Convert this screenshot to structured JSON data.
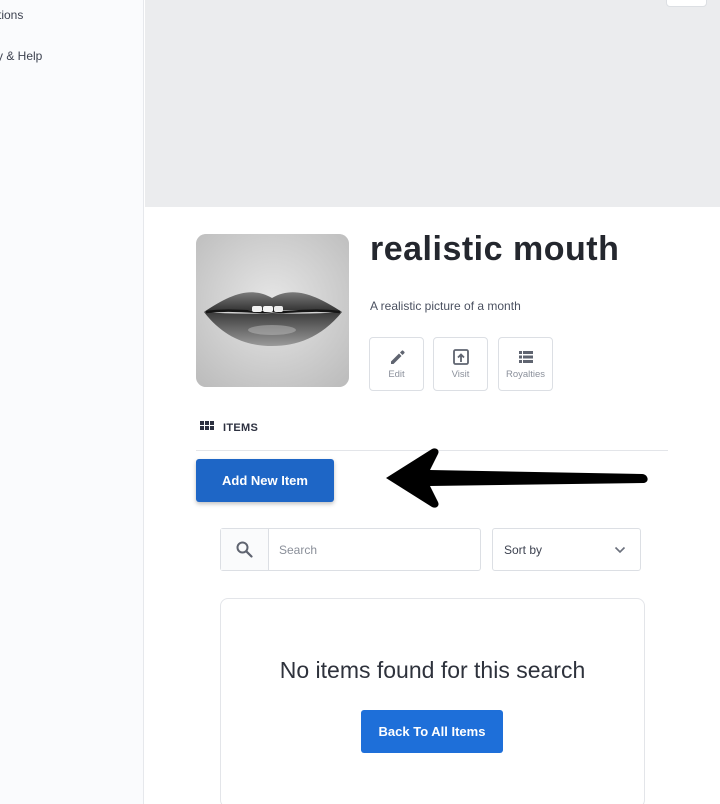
{
  "sidebar": {
    "items": [
      {
        "label": "tions"
      },
      {
        "label": "y & Help"
      }
    ]
  },
  "collection": {
    "title": "realistic mouth",
    "description": "A realistic picture of a month",
    "actions": [
      {
        "label": "Edit",
        "icon": "pencil-icon"
      },
      {
        "label": "Visit",
        "icon": "open-external-icon"
      },
      {
        "label": "Royalties",
        "icon": "list-icon"
      }
    ]
  },
  "items_section": {
    "heading": "ITEMS",
    "heading_icon": "grid-icon",
    "add_button": "Add New Item"
  },
  "search": {
    "placeholder": "Search",
    "value": "",
    "sort_label": "Sort by"
  },
  "empty_state": {
    "message": "No items found for this search",
    "back_button": "Back To All Items"
  },
  "colors": {
    "primary": "#1e66c6",
    "back_button": "#1e6fd9",
    "banner": "#ebecee"
  }
}
